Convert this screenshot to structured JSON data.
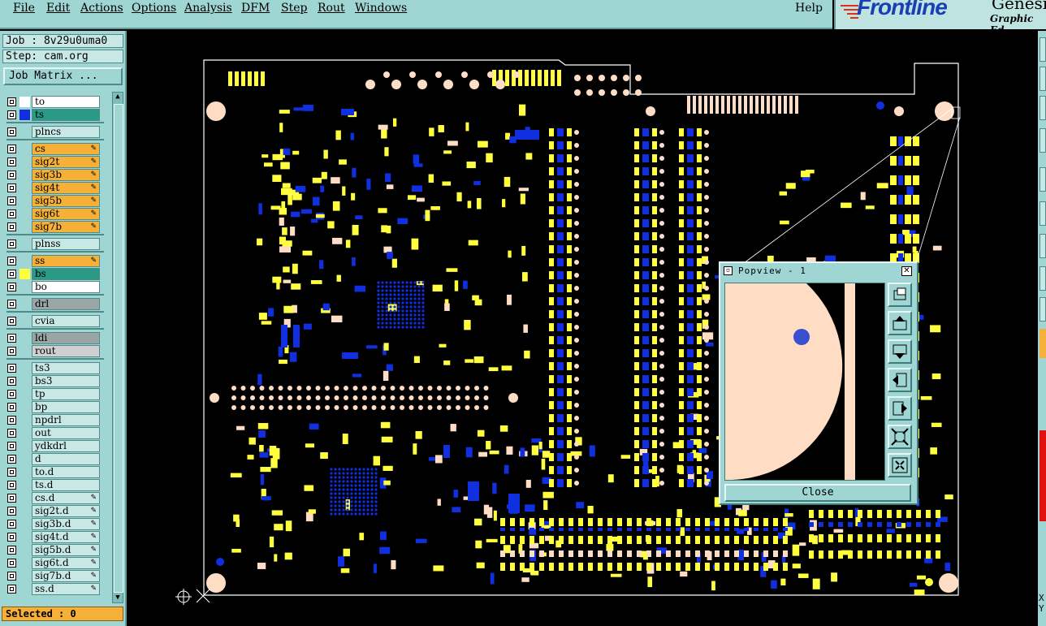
{
  "menu": [
    "File",
    "Edit",
    "Actions",
    "Options",
    "Analysis",
    "DFM",
    "Step",
    "Rout",
    "Windows"
  ],
  "help": "Help",
  "logo": {
    "brand": "Frontline",
    "product": "Genesis",
    "subtitle": "Graphic Ed"
  },
  "job_label": "Job : 8v29u0uma0",
  "step_label": "Step: cam.org",
  "job_matrix_button": "Job Matrix ...",
  "layers": [
    {
      "name": "to",
      "color": "#ffffff",
      "swatch": "#ffffff",
      "mark": ""
    },
    {
      "name": "ts",
      "color": "#2a9a86",
      "swatch": "#1030e0",
      "mark": ""
    },
    {
      "name": "plncs",
      "color": "#c8e8e6",
      "swatch": "",
      "mark": ""
    },
    {
      "name": "cs",
      "color": "#f5b03a",
      "swatch": "",
      "mark": "✎"
    },
    {
      "name": "sig2t",
      "color": "#f5b03a",
      "swatch": "",
      "mark": "✎"
    },
    {
      "name": "sig3b",
      "color": "#f5b03a",
      "swatch": "",
      "mark": "✎"
    },
    {
      "name": "sig4t",
      "color": "#f5b03a",
      "swatch": "",
      "mark": "✎"
    },
    {
      "name": "sig5b",
      "color": "#f5b03a",
      "swatch": "",
      "mark": "✎"
    },
    {
      "name": "sig6t",
      "color": "#f5b03a",
      "swatch": "",
      "mark": "✎"
    },
    {
      "name": "sig7b",
      "color": "#f5b03a",
      "swatch": "",
      "mark": "✎"
    },
    {
      "name": "plnss",
      "color": "#c8e8e6",
      "swatch": "",
      "mark": ""
    },
    {
      "name": "ss",
      "color": "#f5b03a",
      "swatch": "",
      "mark": "✎"
    },
    {
      "name": "bs",
      "color": "#2a9a86",
      "swatch": "#ffff40",
      "mark": ""
    },
    {
      "name": "bo",
      "color": "#ffffff",
      "swatch": "",
      "mark": ""
    },
    {
      "name": "drl",
      "color": "#9aa6a6",
      "swatch": "",
      "mark": ""
    },
    {
      "name": "cvia",
      "color": "#c8e8e6",
      "swatch": "",
      "mark": ""
    },
    {
      "name": "ldi",
      "color": "#9aa6a6",
      "swatch": "",
      "mark": ""
    },
    {
      "name": "rout",
      "color": "#d0d0d0",
      "swatch": "",
      "mark": ""
    },
    {
      "name": "ts3",
      "color": "#c8e8e6",
      "swatch": "",
      "mark": ""
    },
    {
      "name": "bs3",
      "color": "#c8e8e6",
      "swatch": "",
      "mark": ""
    },
    {
      "name": "tp",
      "color": "#c8e8e6",
      "swatch": "",
      "mark": ""
    },
    {
      "name": "bp",
      "color": "#c8e8e6",
      "swatch": "",
      "mark": ""
    },
    {
      "name": "npdrl",
      "color": "#c8e8e6",
      "swatch": "",
      "mark": ""
    },
    {
      "name": "out",
      "color": "#c8e8e6",
      "swatch": "",
      "mark": ""
    },
    {
      "name": "ydkdrl",
      "color": "#c8e8e6",
      "swatch": "",
      "mark": ""
    },
    {
      "name": "d",
      "color": "#c8e8e6",
      "swatch": "",
      "mark": ""
    },
    {
      "name": "to.d",
      "color": "#c8e8e6",
      "swatch": "",
      "mark": ""
    },
    {
      "name": "ts.d",
      "color": "#c8e8e6",
      "swatch": "",
      "mark": ""
    },
    {
      "name": "cs.d",
      "color": "#c8e8e6",
      "swatch": "",
      "mark": "✎"
    },
    {
      "name": "sig2t.d",
      "color": "#c8e8e6",
      "swatch": "",
      "mark": "✎"
    },
    {
      "name": "sig3b.d",
      "color": "#c8e8e6",
      "swatch": "",
      "mark": "✎"
    },
    {
      "name": "sig4t.d",
      "color": "#c8e8e6",
      "swatch": "",
      "mark": "✎"
    },
    {
      "name": "sig5b.d",
      "color": "#c8e8e6",
      "swatch": "",
      "mark": "✎"
    },
    {
      "name": "sig6t.d",
      "color": "#c8e8e6",
      "swatch": "",
      "mark": "✎"
    },
    {
      "name": "sig7b.d",
      "color": "#c8e8e6",
      "swatch": "",
      "mark": "✎"
    },
    {
      "name": "ss.d",
      "color": "#c8e8e6",
      "swatch": "",
      "mark": "✎"
    }
  ],
  "selected_label": "Selected : 0",
  "popview": {
    "title": "Popview - 1",
    "close_button": "Close",
    "tools": [
      "zoom-fit-icon",
      "pan-up-icon",
      "pan-down-icon",
      "pan-left-icon",
      "pan-right-icon",
      "zoom-in-icon",
      "zoom-out-icon"
    ]
  },
  "right_strip": {
    "coord_x": "X",
    "coord_y": "Y"
  },
  "colors": {
    "panel": "#9fd6d4",
    "copper_yellow": "#ffff40",
    "mask_blue": "#1030e0",
    "pad_peach": "#ffdcc4",
    "board_outline": "#ffffff"
  }
}
